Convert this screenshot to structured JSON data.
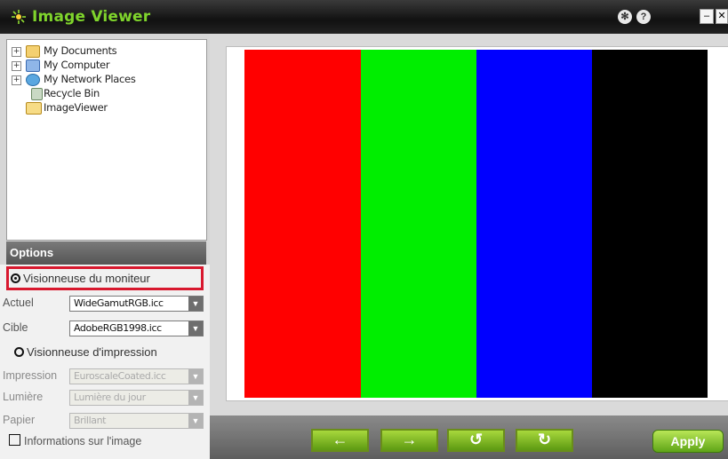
{
  "window": {
    "title": "Image Viewer",
    "title_color": "#7fd42c"
  },
  "tree": {
    "items": [
      {
        "label": "My Documents",
        "icon": "folder-documents-icon",
        "expander": "+"
      },
      {
        "label": "My Computer",
        "icon": "computer-icon",
        "expander": "+"
      },
      {
        "label": "My Network Places",
        "icon": "network-places-icon",
        "expander": "+"
      },
      {
        "label": "Recycle Bin",
        "icon": "recycle-bin-icon",
        "expander": ""
      },
      {
        "label": "ImageViewer",
        "icon": "open-folder-icon",
        "expander": ""
      }
    ]
  },
  "options": {
    "header": "Options",
    "monitor_radio": "Visionneuse du moniteur",
    "actuel_label": "Actuel",
    "actuel_value": "WideGamutRGB.icc",
    "cible_label": "Cible",
    "cible_value": "AdobeRGB1998.icc",
    "print_radio": "Visionneuse d'impression",
    "impression_label": "Impression",
    "impression_value": "EuroscaleCoated.icc",
    "lumiere_label": "Lumière",
    "lumiere_value": "Lumière du jour",
    "papier_label": "Papier",
    "papier_value": "Brillant",
    "info_checkbox": "Informations sur l'image",
    "highlight_color": "#d8182e"
  },
  "viewer": {
    "stripes": [
      "#ff0000",
      "#00ee00",
      "#0000ff",
      "#000000"
    ]
  },
  "toolbar": {
    "prev_icon": "arrow-left-icon",
    "next_icon": "arrow-right-icon",
    "rotate_ccw_icon": "rotate-left-icon",
    "rotate_cw_icon": "rotate-right-icon",
    "apply_label": "Apply"
  }
}
